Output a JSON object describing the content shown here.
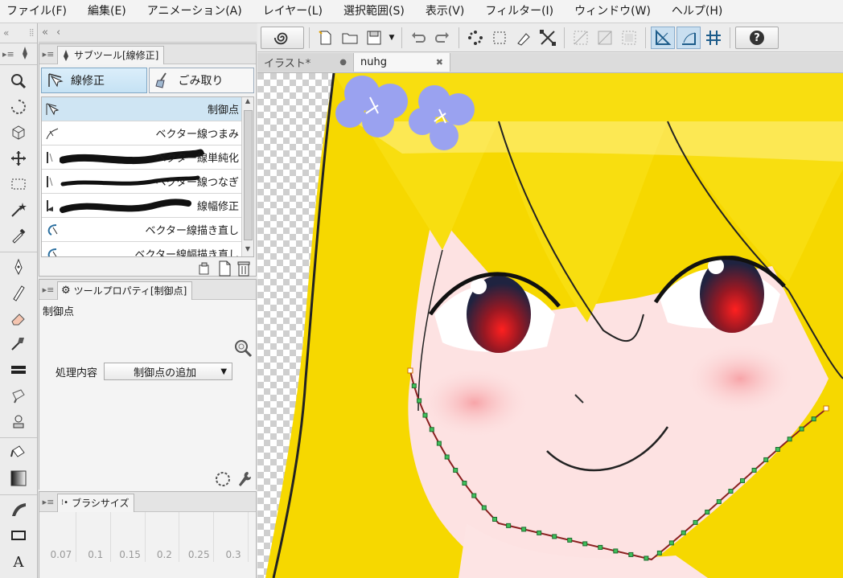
{
  "menu": [
    "ファイル(F)",
    "編集(E)",
    "アニメーション(A)",
    "レイヤー(L)",
    "選択範囲(S)",
    "表示(V)",
    "フィルター(I)",
    "ウィンドウ(W)",
    "ヘルプ(H)"
  ],
  "subtool_panel": {
    "tab_label": "サブツール[線修正]",
    "groups": [
      "線修正",
      "ごみ取り"
    ],
    "items": [
      "制御点",
      "ベクター線つまみ",
      "ベクター線単純化",
      "ベクター線つなぎ",
      "線幅修正",
      "ベクター線描き直し",
      "ベクター線幅描き直し"
    ]
  },
  "tool_property": {
    "tab_label": "ツールプロパティ[制御点]",
    "tool_name": "制御点",
    "process_label": "処理内容",
    "process_value": "制御点の追加"
  },
  "brush_size": {
    "tab_label": "ブラシサイズ",
    "sizes": [
      "0.07",
      "0.1",
      "0.15",
      "0.2",
      "0.25",
      "0.3"
    ]
  },
  "documents": {
    "tabs": [
      {
        "title": "イラスト*",
        "close": "●"
      },
      {
        "title": "nuhg",
        "close": "✖"
      }
    ]
  },
  "colors": {
    "hair": "#f6d800",
    "skin": "#fde2e2",
    "flower": "#9aa2f0",
    "accent_selected": "#c9dff0",
    "eye": "#e01818"
  },
  "icons": {
    "toolbox": [
      "zoom-icon",
      "rotate-icon",
      "cube-icon",
      "move-icon",
      "rect-select-icon",
      "magic-wand-icon",
      "eyedropper-icon",
      "pen-icon",
      "pencil-icon",
      "eraser-icon",
      "brush-icon",
      "fill-black-icon",
      "blend-icon",
      "stamp-icon",
      "bucket-icon",
      "gradient-icon",
      "ruler-icon",
      "shape-rect-icon",
      "text-icon"
    ]
  }
}
